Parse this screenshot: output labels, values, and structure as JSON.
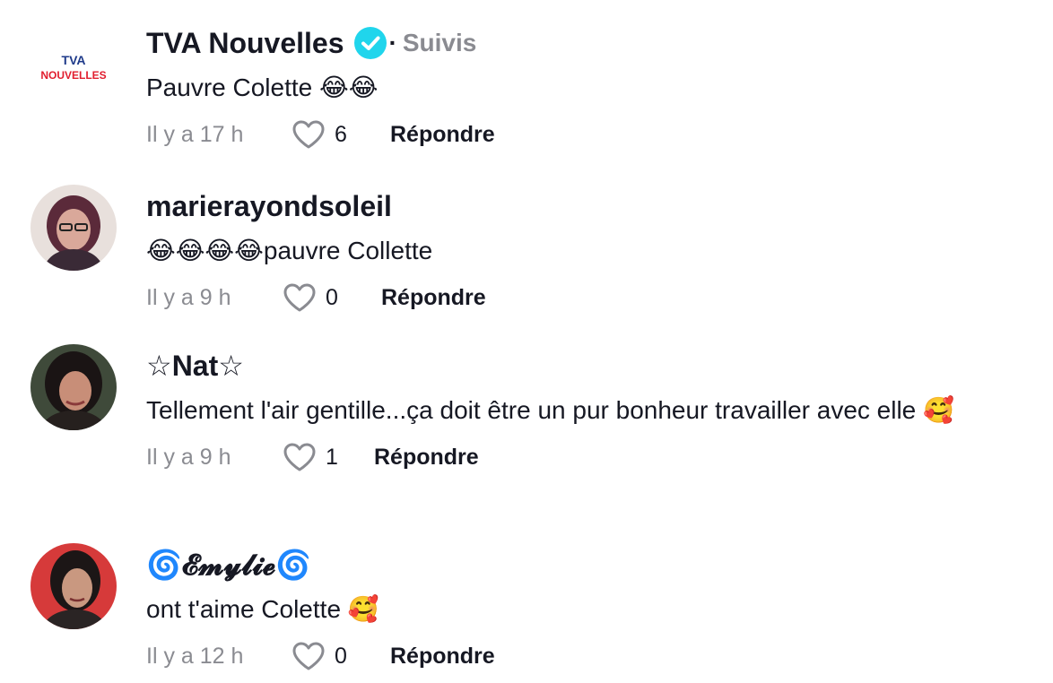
{
  "comments": [
    {
      "author": "TVA Nouvelles",
      "verified": true,
      "follow_status": "Suivis",
      "text": "Pauvre Colette 😂😂",
      "time": "Il y a 17 h",
      "likes": "6",
      "reply": "Répondre",
      "avatar_logo_top": "TVA",
      "avatar_logo_bottom": "NOUVELLES"
    },
    {
      "author": "marierayondsoleil",
      "text": "😂😂😂😂pauvre Collette",
      "time": "Il y a 9 h",
      "likes": "0",
      "reply": "Répondre"
    },
    {
      "author": "☆Nat☆",
      "text": "Tellement l'air gentille...ça doit être un pur bonheur travailler avec elle 🥰",
      "time": "Il y a 9 h",
      "likes": "1",
      "reply": "Répondre"
    },
    {
      "author": "🌀𝓔𝓶𝔂𝓵𝓲𝓮🌀",
      "text": "ont t'aime Colette 🥰",
      "time": "Il y a 12 h",
      "likes": "0",
      "reply": "Répondre"
    }
  ],
  "colors": {
    "verified_badge": "#20d5ec",
    "muted_text": "#8a8b91",
    "primary_text": "#161823",
    "tva_blue": "#1e3a8a",
    "tva_red": "#e11d2e"
  },
  "icons": [
    "verified-check-icon",
    "heart-outline-icon"
  ]
}
